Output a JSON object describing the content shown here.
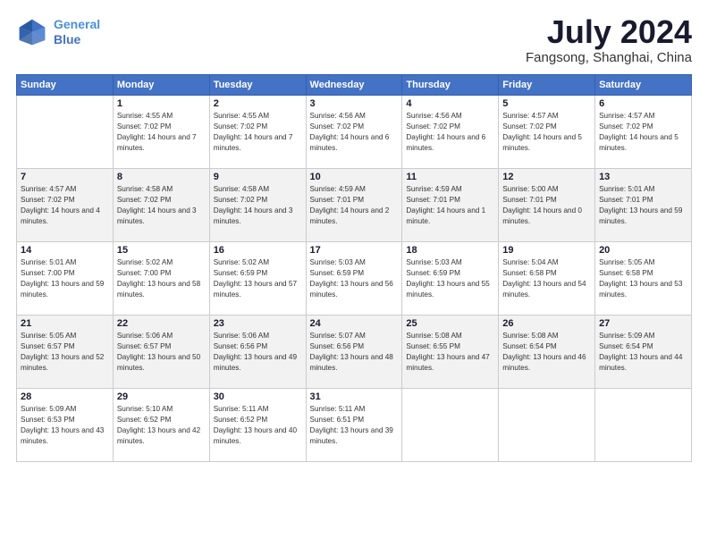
{
  "header": {
    "logo_line1": "General",
    "logo_line2": "Blue",
    "month": "July 2024",
    "location": "Fangsong, Shanghai, China"
  },
  "weekdays": [
    "Sunday",
    "Monday",
    "Tuesday",
    "Wednesday",
    "Thursday",
    "Friday",
    "Saturday"
  ],
  "weeks": [
    [
      {
        "day": "",
        "sunrise": "",
        "sunset": "",
        "daylight": ""
      },
      {
        "day": "1",
        "sunrise": "Sunrise: 4:55 AM",
        "sunset": "Sunset: 7:02 PM",
        "daylight": "Daylight: 14 hours and 7 minutes."
      },
      {
        "day": "2",
        "sunrise": "Sunrise: 4:55 AM",
        "sunset": "Sunset: 7:02 PM",
        "daylight": "Daylight: 14 hours and 7 minutes."
      },
      {
        "day": "3",
        "sunrise": "Sunrise: 4:56 AM",
        "sunset": "Sunset: 7:02 PM",
        "daylight": "Daylight: 14 hours and 6 minutes."
      },
      {
        "day": "4",
        "sunrise": "Sunrise: 4:56 AM",
        "sunset": "Sunset: 7:02 PM",
        "daylight": "Daylight: 14 hours and 6 minutes."
      },
      {
        "day": "5",
        "sunrise": "Sunrise: 4:57 AM",
        "sunset": "Sunset: 7:02 PM",
        "daylight": "Daylight: 14 hours and 5 minutes."
      },
      {
        "day": "6",
        "sunrise": "Sunrise: 4:57 AM",
        "sunset": "Sunset: 7:02 PM",
        "daylight": "Daylight: 14 hours and 5 minutes."
      }
    ],
    [
      {
        "day": "7",
        "sunrise": "Sunrise: 4:57 AM",
        "sunset": "Sunset: 7:02 PM",
        "daylight": "Daylight: 14 hours and 4 minutes."
      },
      {
        "day": "8",
        "sunrise": "Sunrise: 4:58 AM",
        "sunset": "Sunset: 7:02 PM",
        "daylight": "Daylight: 14 hours and 3 minutes."
      },
      {
        "day": "9",
        "sunrise": "Sunrise: 4:58 AM",
        "sunset": "Sunset: 7:02 PM",
        "daylight": "Daylight: 14 hours and 3 minutes."
      },
      {
        "day": "10",
        "sunrise": "Sunrise: 4:59 AM",
        "sunset": "Sunset: 7:01 PM",
        "daylight": "Daylight: 14 hours and 2 minutes."
      },
      {
        "day": "11",
        "sunrise": "Sunrise: 4:59 AM",
        "sunset": "Sunset: 7:01 PM",
        "daylight": "Daylight: 14 hours and 1 minute."
      },
      {
        "day": "12",
        "sunrise": "Sunrise: 5:00 AM",
        "sunset": "Sunset: 7:01 PM",
        "daylight": "Daylight: 14 hours and 0 minutes."
      },
      {
        "day": "13",
        "sunrise": "Sunrise: 5:01 AM",
        "sunset": "Sunset: 7:01 PM",
        "daylight": "Daylight: 13 hours and 59 minutes."
      }
    ],
    [
      {
        "day": "14",
        "sunrise": "Sunrise: 5:01 AM",
        "sunset": "Sunset: 7:00 PM",
        "daylight": "Daylight: 13 hours and 59 minutes."
      },
      {
        "day": "15",
        "sunrise": "Sunrise: 5:02 AM",
        "sunset": "Sunset: 7:00 PM",
        "daylight": "Daylight: 13 hours and 58 minutes."
      },
      {
        "day": "16",
        "sunrise": "Sunrise: 5:02 AM",
        "sunset": "Sunset: 6:59 PM",
        "daylight": "Daylight: 13 hours and 57 minutes."
      },
      {
        "day": "17",
        "sunrise": "Sunrise: 5:03 AM",
        "sunset": "Sunset: 6:59 PM",
        "daylight": "Daylight: 13 hours and 56 minutes."
      },
      {
        "day": "18",
        "sunrise": "Sunrise: 5:03 AM",
        "sunset": "Sunset: 6:59 PM",
        "daylight": "Daylight: 13 hours and 55 minutes."
      },
      {
        "day": "19",
        "sunrise": "Sunrise: 5:04 AM",
        "sunset": "Sunset: 6:58 PM",
        "daylight": "Daylight: 13 hours and 54 minutes."
      },
      {
        "day": "20",
        "sunrise": "Sunrise: 5:05 AM",
        "sunset": "Sunset: 6:58 PM",
        "daylight": "Daylight: 13 hours and 53 minutes."
      }
    ],
    [
      {
        "day": "21",
        "sunrise": "Sunrise: 5:05 AM",
        "sunset": "Sunset: 6:57 PM",
        "daylight": "Daylight: 13 hours and 52 minutes."
      },
      {
        "day": "22",
        "sunrise": "Sunrise: 5:06 AM",
        "sunset": "Sunset: 6:57 PM",
        "daylight": "Daylight: 13 hours and 50 minutes."
      },
      {
        "day": "23",
        "sunrise": "Sunrise: 5:06 AM",
        "sunset": "Sunset: 6:56 PM",
        "daylight": "Daylight: 13 hours and 49 minutes."
      },
      {
        "day": "24",
        "sunrise": "Sunrise: 5:07 AM",
        "sunset": "Sunset: 6:56 PM",
        "daylight": "Daylight: 13 hours and 48 minutes."
      },
      {
        "day": "25",
        "sunrise": "Sunrise: 5:08 AM",
        "sunset": "Sunset: 6:55 PM",
        "daylight": "Daylight: 13 hours and 47 minutes."
      },
      {
        "day": "26",
        "sunrise": "Sunrise: 5:08 AM",
        "sunset": "Sunset: 6:54 PM",
        "daylight": "Daylight: 13 hours and 46 minutes."
      },
      {
        "day": "27",
        "sunrise": "Sunrise: 5:09 AM",
        "sunset": "Sunset: 6:54 PM",
        "daylight": "Daylight: 13 hours and 44 minutes."
      }
    ],
    [
      {
        "day": "28",
        "sunrise": "Sunrise: 5:09 AM",
        "sunset": "Sunset: 6:53 PM",
        "daylight": "Daylight: 13 hours and 43 minutes."
      },
      {
        "day": "29",
        "sunrise": "Sunrise: 5:10 AM",
        "sunset": "Sunset: 6:52 PM",
        "daylight": "Daylight: 13 hours and 42 minutes."
      },
      {
        "day": "30",
        "sunrise": "Sunrise: 5:11 AM",
        "sunset": "Sunset: 6:52 PM",
        "daylight": "Daylight: 13 hours and 40 minutes."
      },
      {
        "day": "31",
        "sunrise": "Sunrise: 5:11 AM",
        "sunset": "Sunset: 6:51 PM",
        "daylight": "Daylight: 13 hours and 39 minutes."
      },
      {
        "day": "",
        "sunrise": "",
        "sunset": "",
        "daylight": ""
      },
      {
        "day": "",
        "sunrise": "",
        "sunset": "",
        "daylight": ""
      },
      {
        "day": "",
        "sunrise": "",
        "sunset": "",
        "daylight": ""
      }
    ]
  ]
}
